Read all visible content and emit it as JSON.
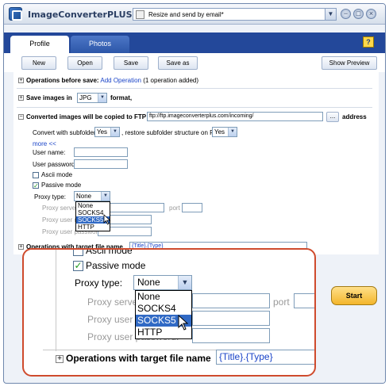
{
  "app": {
    "title": "ImageConverterPLUS",
    "preset": "Resize and send by email*",
    "window_buttons": [
      "−",
      "□",
      "×"
    ]
  },
  "tabs": [
    {
      "label": "Profile"
    },
    {
      "label": "Photos"
    }
  ],
  "help": "?",
  "toolbar": {
    "new": "New",
    "open": "Open",
    "save": "Save",
    "save_as": "Save as",
    "show_preview": "Show Preview"
  },
  "sections": {
    "operations_before_save": {
      "label": "Operations before save:",
      "link": "Add Operation",
      "note": "(1 operation added)"
    },
    "save_images": {
      "prefix": "Save images in",
      "format": "JPG",
      "suffix": "format,"
    },
    "ftp": {
      "label": "Converted images will be copied to FTP",
      "url": "ftp://ftp.imageconverterplus.com/incoming/",
      "browse": "...",
      "address": "address",
      "convert_subfolders_label": "Convert with subfolders",
      "convert_subfolders_value": "Yes",
      "restore_label": ", restore subfolder structure on FTP",
      "restore_value": "Yes",
      "more": "more <<",
      "user_name": "User name:",
      "user_password": "User password:",
      "ascii_mode": "Ascii mode",
      "passive_mode": "Passive mode",
      "proxy_type": "Proxy type:",
      "proxy_value": "None",
      "proxy_server": "Proxy server:",
      "port": "port",
      "proxy_user_name": "Proxy user name:",
      "proxy_user_password": "Proxy user password:",
      "proxy_options": [
        "None",
        "SOCKS4",
        "SOCKS5",
        "HTTP"
      ],
      "proxy_highlighted": "SOCKS5"
    },
    "operations_target": {
      "label": "Operations with target file name",
      "value": "{Title}.{Type}"
    }
  },
  "start_button": "Start",
  "check_mark": "✓",
  "plus_sign": "+"
}
